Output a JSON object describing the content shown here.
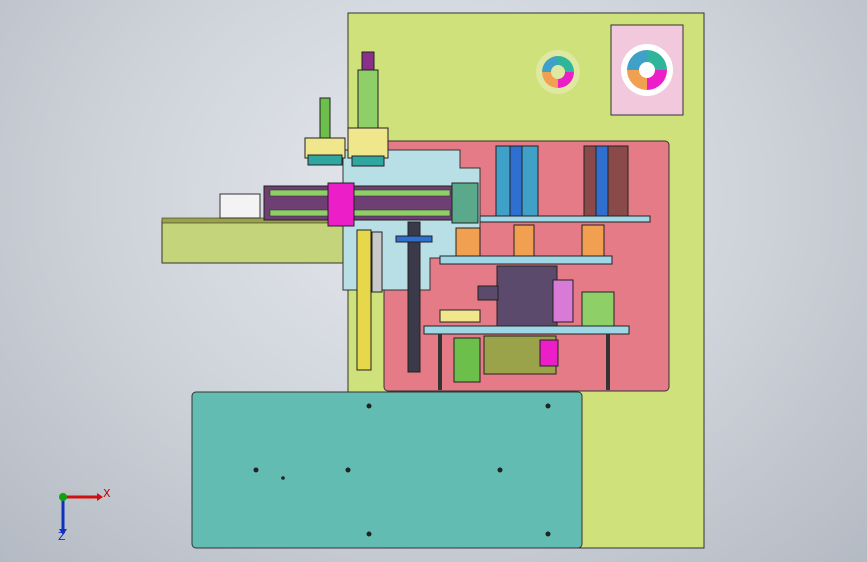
{
  "colors": {
    "base_plate": "#cfe17a",
    "pink_panel": "#e57b86",
    "teal_block": "#63bcb2",
    "slide_rail": "#6e3f73",
    "magenta": "#ec1ec8",
    "motor_dark": "#5b4a6b",
    "olive": "#9aa24a",
    "blue_part": "#2f6fd0",
    "axis_x": "#d01010",
    "axis_y": "#10a010",
    "axis_z": "#1030c0"
  },
  "triad": {
    "x_label": "X",
    "y_label": "Y",
    "z_label": "Z"
  },
  "icons": {
    "view_cube_small": "view-orientation-icon",
    "view_cube_large": "view-orientation-icon"
  }
}
